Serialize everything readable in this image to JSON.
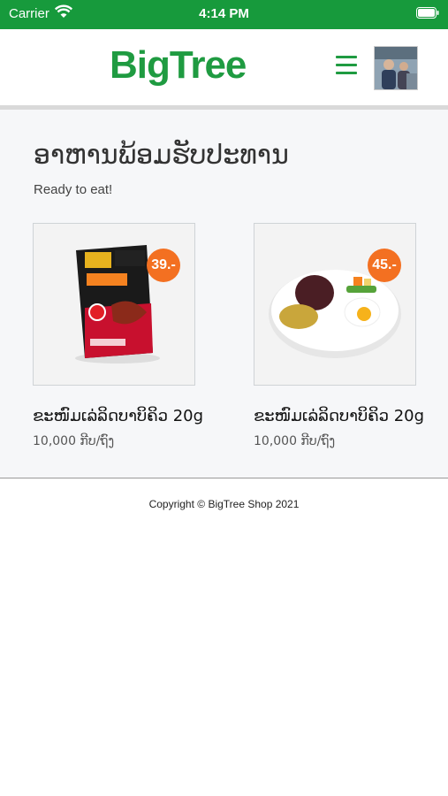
{
  "status_bar": {
    "carrier": "Carrier",
    "time": "4:14 PM"
  },
  "header": {
    "logo": "BigTree",
    "menu_icon": "hamburger-icon",
    "avatar_icon": "user-avatar"
  },
  "page": {
    "title": "ອາຫານພ້ອມຮັບປະທານ",
    "subtitle": "Ready to eat!"
  },
  "products": [
    {
      "name": "ຂະໜົມເລ່ລິດບາບິຄິວ 20g",
      "price": "10,000 ກີບ/ຖົງ",
      "badge": "39.-",
      "image": "snack-package"
    },
    {
      "name": "ຂະໜົມເລ່ລິດບາບິຄິວ 20g",
      "price": "10,000 ກີບ/ຖົງ",
      "badge": "45.-",
      "image": "rice-plate"
    }
  ],
  "footer": {
    "copyright": "Copyright © BigTree Shop 2021"
  },
  "colors": {
    "brand_green": "#1f9b41",
    "status_green": "#179a3c",
    "badge_orange": "#f37021"
  }
}
